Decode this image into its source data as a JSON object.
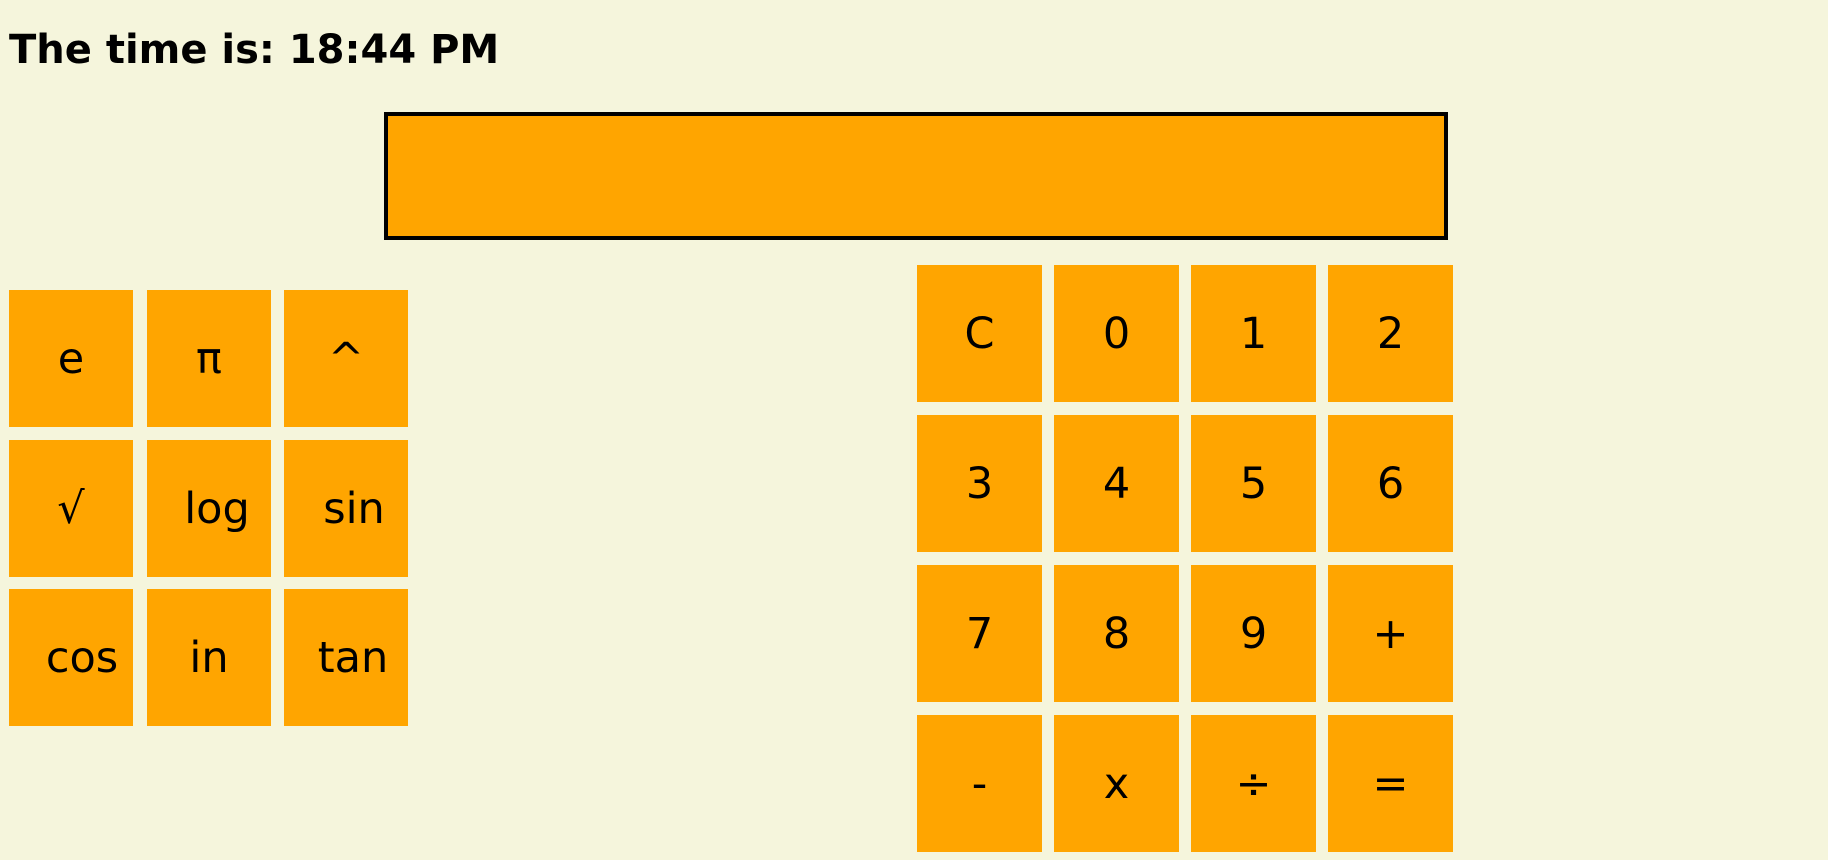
{
  "header": {
    "time_text": "The time is: 18:44 PM"
  },
  "display": {
    "value": ""
  },
  "scientific_pad": {
    "buttons": [
      "e",
      "π",
      "^",
      "√",
      "log",
      "sin",
      "cos",
      "in",
      "tan"
    ]
  },
  "number_pad": {
    "buttons": [
      "C",
      "0",
      "1",
      "2",
      "3",
      "4",
      "5",
      "6",
      "7",
      "8",
      "9",
      "+",
      "-",
      "x",
      "÷",
      "="
    ]
  },
  "colors": {
    "background": "#f5f5dc",
    "button": "#ffa500",
    "display_border": "#000000"
  }
}
